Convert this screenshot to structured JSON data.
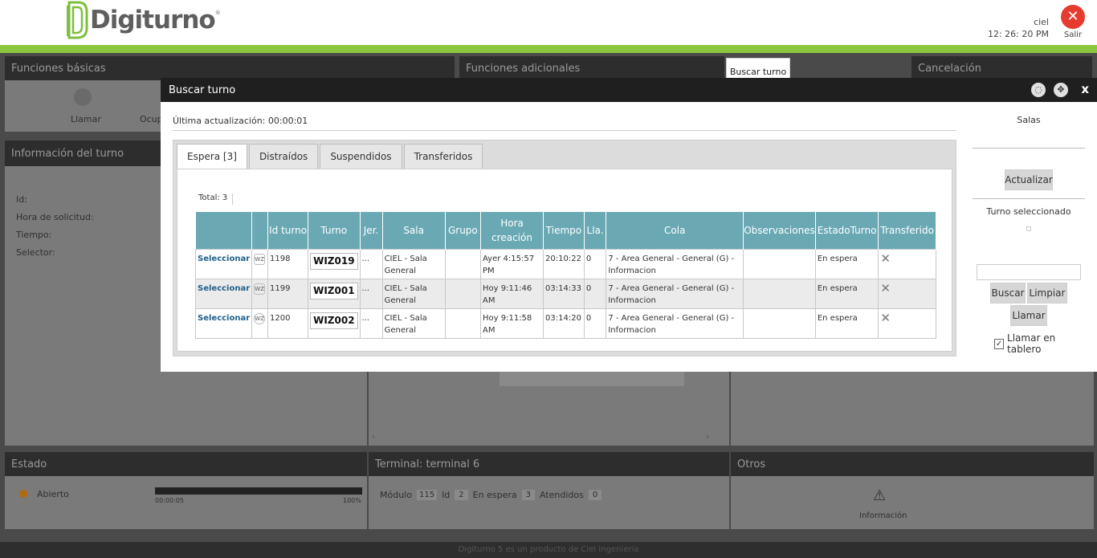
{
  "header": {
    "logo_text": "Digiturno",
    "logo_reg": "®",
    "username": "ciel",
    "clock": "12: 26: 20 PM",
    "exit_label": "Salir"
  },
  "background": {
    "tabs": [
      "Funciones básicas",
      "Funciones adicionales",
      "Cancelación"
    ],
    "hover_tooltip": "Buscar turno",
    "basic_buttons": [
      "Llamar",
      "Ocup"
    ],
    "info_title": "Información del turno",
    "info_fields": [
      "Id:",
      "Hora de solicitud:",
      "Tiempo:",
      "Selector:"
    ],
    "estado": {
      "title": "Estado",
      "status": "Abierto",
      "progress_start": "00:00:05",
      "progress_end": "100%",
      "progress": 1.0
    },
    "terminal": {
      "title": "Terminal: terminal 6",
      "modulo_label": "Módulo",
      "modulo": "115",
      "id_label": "Id",
      "id": "2",
      "espera_label": "En espera",
      "espera": "3",
      "atendidos_label": "Atendidos",
      "atendidos": "0"
    },
    "otros": {
      "title": "Otros",
      "info_label": "Información"
    },
    "footer": "Digiturno 5 es un producto de Ciel Ingeniería"
  },
  "modal": {
    "title": "Buscar turno",
    "close": "x",
    "last_update": "Última actualización: 00:00:01",
    "tabs": [
      "Espera [3]",
      "Distraídos",
      "Suspendidos",
      "Transferidos"
    ],
    "total_label": "Total:",
    "total": "3",
    "columns": [
      "",
      "",
      "Id turno",
      "Turno",
      "Jer.",
      "Sala",
      "Grupo",
      "Hora creación",
      "Tiempo",
      "Lla.",
      "Cola",
      "Observaciones",
      "EstadoTurno",
      "Transferido"
    ],
    "rows": [
      {
        "select": "Seleccionar",
        "badge": "WZ",
        "id": "1198",
        "turno": "WIZ019",
        "jer": "...",
        "sala": "CIEL - Sala General",
        "grupo": "",
        "hora": "Ayer 4:15:57 PM",
        "tiempo": "20:10:22",
        "lla": "0",
        "cola": "7 - Area General - General (G) - Informacion",
        "obs": "",
        "estado": "En espera",
        "transferido": "✕"
      },
      {
        "select": "Seleccionar",
        "badge": "WZ",
        "id": "1199",
        "turno": "WIZ001",
        "jer": "...",
        "sala": "CIEL - Sala General",
        "grupo": "",
        "hora": "Hoy 9:11:46 AM",
        "tiempo": "03:14:33",
        "lla": "0",
        "cola": "7 - Area General - General (G) - Informacion",
        "obs": "",
        "estado": "En espera",
        "transferido": "✕"
      },
      {
        "select": "Seleccionar",
        "badge": "WZ",
        "id": "1200",
        "turno": "WIZ002",
        "jer": "...",
        "sala": "CIEL - Sala General",
        "grupo": "",
        "hora": "Hoy 9:11:58 AM",
        "tiempo": "03:14:20",
        "lla": "0",
        "cola": "7 - Area General - General (G) - Informacion",
        "obs": "",
        "estado": "En espera",
        "transferido": "✕"
      }
    ],
    "side": {
      "salas_title": "Salas",
      "actualizar": "Actualizar",
      "turno_seleccionado": "Turno seleccionado",
      "buscar": "Buscar",
      "limpiar": "Limpiar",
      "llamar": "Llamar",
      "llamar_tablero": "Llamar en tablero",
      "llamar_tablero_checked": true
    }
  },
  "colors": {
    "brand_green": "#8cc63f",
    "table_header": "#6aa9b4",
    "exit_red": "#e63b2e"
  }
}
